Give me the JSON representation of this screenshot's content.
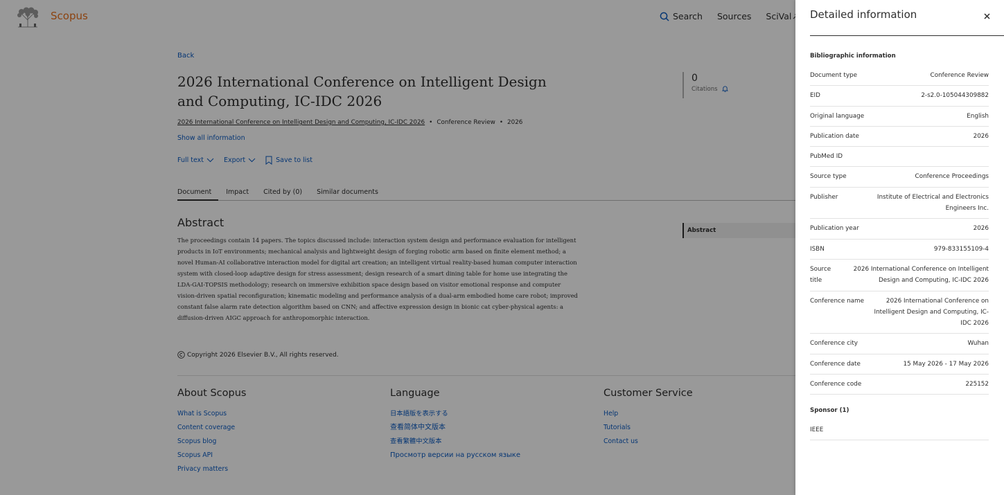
{
  "header": {
    "brand": "Scopus",
    "nav": [
      {
        "label": "Search",
        "icon": "search-icon"
      },
      {
        "label": "Sources"
      },
      {
        "label": "SciVal",
        "icon": "external-link-icon"
      }
    ]
  },
  "document": {
    "back_label": "Back",
    "title": "2026 International Conference on Intelligent Design and Computing, IC-IDC 2026",
    "source_link": "2026 International Conference on Intelligent Design and Computing, IC-IDC 2026",
    "doc_type": "Conference Review",
    "year": "2026",
    "show_all": "Show all information",
    "citations": {
      "count": "0",
      "label": "Citations"
    },
    "actions": {
      "full_text": "Full text",
      "export": "Export",
      "save": "Save to list"
    },
    "tabs": [
      "Document",
      "Impact",
      "Cited by (0)",
      "Similar documents"
    ],
    "abstract_heading": "Abstract",
    "abstract_text": "The proceedings contain 14 papers. The topics discussed include: interaction system design and performance evaluation for intelligent products in IoT environments; mechanical analysis and lightweight design of forging robotic arm based on finite element method; a novel Human-AI collaborative interaction model for digital art creation; an intelligent virtual reality-based human computer interaction system with closed-loop adaptive design for stress assessment; design research of a smart dining table for home use integrating the LDA-GAI-TOPSIS methodology; research on immersive exhibition space design based on visitor emotional response and computer vision-driven spatial reconfiguration; kinematic modeling and performance analysis of a dual-arm embodied home care robot; improved constant false alarm rate detection algorithm based on CNN; and affective expression design in bionic cat cyber-physical agents: a diffusion-driven AIGC approach for anthropomorphic interaction.",
    "outline_abstract": "Abstract",
    "copyright": "Copyright 2026 Elsevier B.V., All rights reserved."
  },
  "footer": {
    "about": {
      "heading": "About Scopus",
      "links": [
        "What is Scopus",
        "Content coverage",
        "Scopus blog",
        "Scopus API",
        "Privacy matters"
      ]
    },
    "language": {
      "heading": "Language",
      "links": [
        "日本語版を表示する",
        "查看简体中文版本",
        "查看繁體中文版本",
        "Просмотр версии на русском языке"
      ]
    },
    "service": {
      "heading": "Customer Service",
      "links": [
        "Help",
        "Tutorials",
        "Contact us"
      ]
    }
  },
  "drawer": {
    "title": "Detailed information",
    "bibliographic_heading": "Bibliographic information",
    "fields": [
      {
        "key": "Document type",
        "value": "Conference Review"
      },
      {
        "key": "EID",
        "value": "2-s2.0-105044309882"
      },
      {
        "key": "Original language",
        "value": "English"
      },
      {
        "key": "Publication date",
        "value": "2026"
      },
      {
        "key": "PubMed ID",
        "value": ""
      },
      {
        "key": "Source type",
        "value": "Conference Proceedings"
      },
      {
        "key": "Publisher",
        "value": "Institute of Electrical and Electronics Engineers Inc."
      },
      {
        "key": "Publication year",
        "value": "2026"
      },
      {
        "key": "ISBN",
        "value": "979-833155109-4"
      },
      {
        "key": "Source title",
        "value": "2026 International Conference on Intelligent Design and Computing, IC-IDC 2026"
      },
      {
        "key": "Conference name",
        "value": "2026 International Conference on Intelligent Design and Computing, IC-IDC 2026"
      },
      {
        "key": "Conference city",
        "value": "Wuhan"
      },
      {
        "key": "Conference date",
        "value": "15 May 2026 - 17 May 2026"
      },
      {
        "key": "Conference code",
        "value": "225152"
      }
    ],
    "sponsor_heading": "Sponsor (1)",
    "sponsors": [
      "IEEE"
    ]
  },
  "colors": {
    "brand": "#e9711c",
    "link": "#0a5ac2",
    "text": "#2e2e2e"
  }
}
